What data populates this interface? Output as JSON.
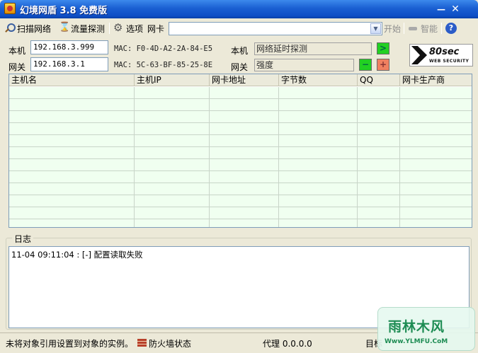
{
  "window": {
    "title": "幻境网盾 3.8 免费版",
    "min_glyph": "—",
    "close_glyph": "✕"
  },
  "toolbar": {
    "scan_label": "扫描网络",
    "sniff_label": "流量探测",
    "options_label": "选项",
    "nic_label": "网卡",
    "nic_value": "",
    "start_label": "开始",
    "smart_label": "智能",
    "help_glyph": "?"
  },
  "info": {
    "local_label": "本机",
    "local_ip": "192.168.3.999",
    "local_mac": "MAC: F0-4D-A2-2A-84-E5",
    "gateway_label": "网关",
    "gateway_ip": "192.168.3.1",
    "gateway_mac": "MAC: 5C-63-BF-85-25-8E",
    "local_status_label": "本机",
    "local_status": "网络延时探测",
    "gateway_status_label": "网关",
    "gateway_status": "强度",
    "go_glyph": ">",
    "minus_glyph": "−",
    "plus_glyph": "+"
  },
  "logo": {
    "text": "80sec",
    "sub": "WEB SECURITY"
  },
  "table": {
    "columns": [
      "主机名",
      "主机IP",
      "网卡地址",
      "字节数",
      "QQ",
      "网卡生产商"
    ],
    "rows": []
  },
  "log": {
    "title": "日志",
    "lines": [
      "11-04 09:11:04 : [-] 配置读取失败"
    ]
  },
  "status": {
    "message": "未将对象引用设置到对象的实例。",
    "firewall_label": "防火墙状态",
    "proxy_label": "代理 0.0.0.0",
    "target_label": "目标"
  },
  "watermark": {
    "main": "雨林木风",
    "sub": "Www.YLMFU.CoM"
  },
  "colors": {
    "title_bar": "#1a5fd2",
    "grid_row": "#f0fff0",
    "go_button": "#22d022",
    "plus_button": "#f08060"
  }
}
